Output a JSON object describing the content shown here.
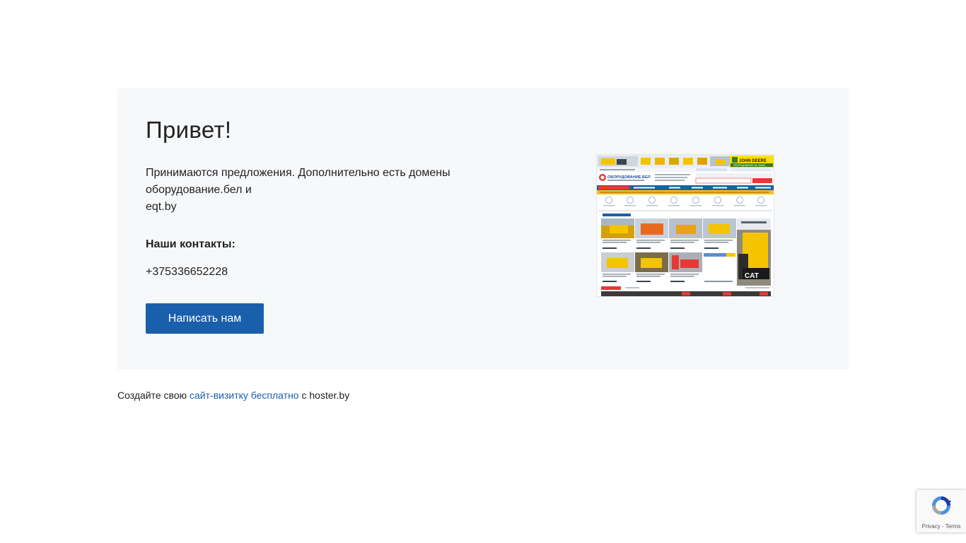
{
  "card": {
    "title": "Привет!",
    "paragraph_lines": [
      "Принимаются предложения. Дополнительно есть домены",
      "оборудование.бел и",
      "eqt.by"
    ],
    "contacts_heading": "Наши контакты:",
    "phone": "+375336652228",
    "button_label": "Написать нам"
  },
  "screenshot": {
    "top_banner_brand": "JOHN DEERE",
    "top_banner_subtitle": "ОБОРУДОВАНИЕ НА ЗАКАЗ",
    "site_logo": "ОБОРУДОВАНИЕ.БЕЛ",
    "ad_brand": "CAT"
  },
  "footer": {
    "prefix": "Создайте свою",
    "link": "сайт-визитку бесплатно",
    "suffix": "с hoster.by"
  },
  "recaptcha": {
    "privacy": "Privacy",
    "separator": "-",
    "terms": "Terms"
  },
  "colors": {
    "accent": "#1a5fac",
    "card_bg": "#f7f8fa",
    "site_red": "#e53935",
    "cat_yellow": "#f5c400"
  }
}
